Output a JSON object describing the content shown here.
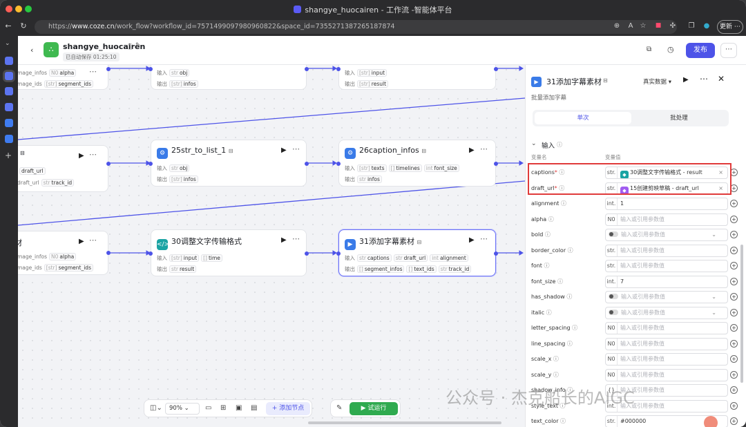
{
  "browser": {
    "window_title": "shangye_huocairen - 工作流 -智能体平台",
    "url_prefix": "https://",
    "url_domain": "www.coze.cn",
    "url_path": "/work_flow?workflow_id=7571499097980960822&space_id=7355271387265187874",
    "update_label": "更新"
  },
  "header": {
    "name": "shangye_huocairen",
    "autosave": "已自动保存 01:25:10",
    "publish": "发布"
  },
  "nodes": [
    {
      "id": "n1",
      "title": "",
      "in_label": "",
      "rows": [
        [
          "mage_infos",
          "N0",
          "alpha",
          "",
          ""
        ],
        [
          "mage_ids",
          "[str]",
          "segment_ids",
          "",
          ""
        ]
      ]
    },
    {
      "id": "n2",
      "title": "",
      "in_label": "输入",
      "in_type": "str",
      "in_val": "obj",
      "out_label": "输出",
      "out_type": "[str]",
      "out_val": "infos"
    },
    {
      "id": "n3",
      "title": "",
      "in_label": "输入",
      "in_type": "[str]",
      "in_val": "input",
      "out_label": "输出",
      "out_type": "[str]",
      "out_val": "result"
    },
    {
      "id": "n4",
      "title": "",
      "r1": "draft_url",
      "r2a": "draft_url",
      "r2b": "track_id"
    },
    {
      "id": "n5",
      "title": "25str_to_list_1",
      "in_label": "输入",
      "in_type": "str",
      "in_val": "obj",
      "out_label": "输出",
      "out_type": "[str]",
      "out_val": "infos"
    },
    {
      "id": "n6",
      "title": "26caption_infos",
      "in_label": "输入",
      "in1": "texts",
      "in2": "timelines",
      "in3": "font_size",
      "in4": "st..in..",
      "out_label": "输出",
      "out_type": "str",
      "out_val": "infos"
    },
    {
      "id": "n7",
      "title": "材",
      "r1a": "mage_infos",
      "r1b": "alpha",
      "r2a": "mage_ids",
      "r2b": "segment_ids"
    },
    {
      "id": "n8",
      "title": "30调整文字传输格式",
      "in_label": "输入",
      "in1": "input",
      "in2": "time",
      "out_label": "输出",
      "out_type": "str",
      "out_val": "result"
    },
    {
      "id": "n9",
      "title": "31添加字幕素材",
      "in_label": "输入",
      "in1": "captions",
      "in2": "draft_url",
      "in3": "alignment",
      "out_label": "输出",
      "o1": "segment_infos",
      "o2": "text_ids",
      "o3": "track_id"
    }
  ],
  "toolbar": {
    "zoom": "90%",
    "add_node": "添加节点",
    "run": "试运行"
  },
  "panel": {
    "title": "31添加字幕素材",
    "mode": "真实数据",
    "subtitle": "批量添加字幕",
    "tab_single": "单次",
    "tab_batch": "批处理",
    "section": "输入",
    "col_name": "变量名",
    "col_value": "变量值",
    "placeholder": "输入或引用参数值",
    "params": [
      {
        "name": "captions",
        "req": "*",
        "type": "str.",
        "ref": "30调整文字传输格式 - result",
        "ref_color": "#1aa3a3"
      },
      {
        "name": "draft_url",
        "req": "*",
        "type": "str.",
        "ref": "15创建剪映草稿 - draft_url",
        "ref_color": "#a05cf0"
      },
      {
        "name": "alignment",
        "type": "int.",
        "value": "1"
      },
      {
        "name": "alpha",
        "type": "N0",
        "value": ""
      },
      {
        "name": "bold",
        "type": "toggle",
        "value": ""
      },
      {
        "name": "border_color",
        "type": "str.",
        "value": ""
      },
      {
        "name": "font",
        "type": "str.",
        "value": ""
      },
      {
        "name": "font_size",
        "type": "int.",
        "value": "7"
      },
      {
        "name": "has_shadow",
        "type": "toggle",
        "value": ""
      },
      {
        "name": "italic",
        "type": "toggle",
        "value": ""
      },
      {
        "name": "letter_spacing",
        "type": "N0",
        "value": ""
      },
      {
        "name": "line_spacing",
        "type": "N0",
        "value": ""
      },
      {
        "name": "scale_x",
        "type": "N0",
        "value": ""
      },
      {
        "name": "scale_y",
        "type": "N0",
        "value": ""
      },
      {
        "name": "shadow_info",
        "type": "{}",
        "value": ""
      },
      {
        "name": "style_text",
        "type": "int.",
        "value": ""
      },
      {
        "name": "text_color",
        "type": "str.",
        "value": "#000000"
      }
    ]
  },
  "watermark": "公众号 · 杰克船长的AIGC"
}
